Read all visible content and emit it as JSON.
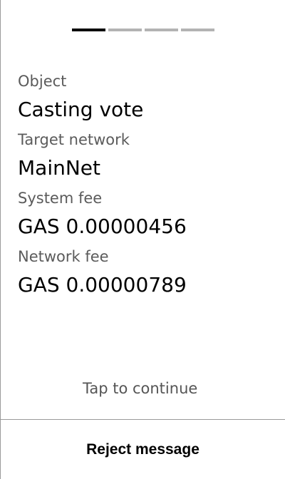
{
  "pager": {
    "total": 4,
    "active_index": 0
  },
  "fields": [
    {
      "label": "Object",
      "value": "Casting vote"
    },
    {
      "label": "Target network",
      "value": "MainNet"
    },
    {
      "label": "System fee",
      "value": "GAS 0.00000456"
    },
    {
      "label": "Network fee",
      "value": "GAS 0.00000789"
    }
  ],
  "hint": "Tap to continue",
  "reject_button": {
    "label": "Reject message"
  },
  "colors": {
    "pager_active": "#000000",
    "pager_inactive": "#b3b3b3",
    "label_text": "#5b5b5b",
    "value_text": "#000000",
    "divider": "#9a9a9a"
  }
}
